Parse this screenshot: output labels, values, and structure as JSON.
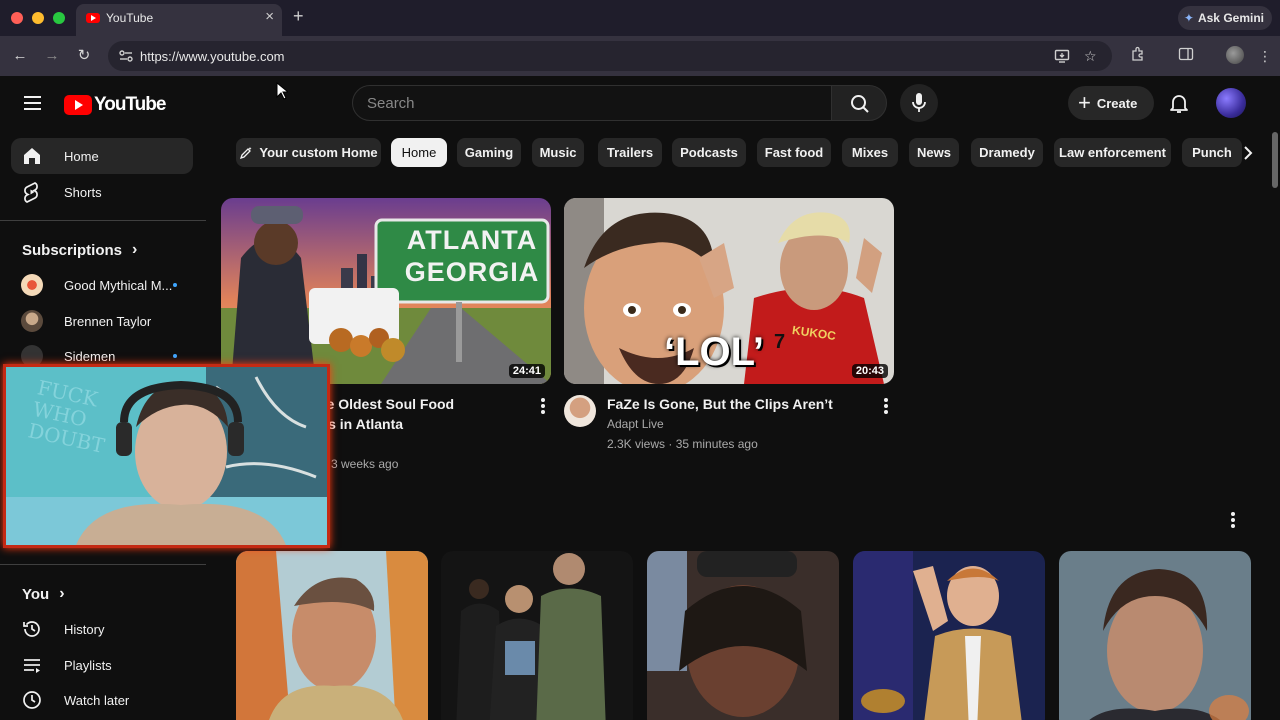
{
  "browser": {
    "tab_title": "YouTube",
    "tab_close": "×",
    "new_tab": "+",
    "ask_gemini": "Ask Gemini",
    "url": "https://www.youtube.com"
  },
  "header": {
    "logo_text": "YouTube",
    "search_placeholder": "Search",
    "create_label": "Create"
  },
  "sidebar": {
    "main": [
      {
        "label": "Home",
        "icon": "home-icon",
        "active": true
      },
      {
        "label": "Shorts",
        "icon": "shorts-icon"
      }
    ],
    "subscriptions_heading": "Subscriptions",
    "subscriptions": [
      {
        "label": "Good Mythical M...",
        "new": true
      },
      {
        "label": "Brennen Taylor",
        "new": false
      },
      {
        "label": "Sidemen",
        "new": true
      }
    ],
    "you_heading": "You",
    "you_items": [
      {
        "label": "History",
        "icon": "history-icon"
      },
      {
        "label": "Playlists",
        "icon": "playlists-icon"
      },
      {
        "label": "Watch later",
        "icon": "watch-later-icon"
      }
    ]
  },
  "chips": [
    "Your custom Home",
    "Home",
    "Gaming",
    "Music",
    "Trailers",
    "Podcasts",
    "Fast food",
    "Mixes",
    "News",
    "Dramedy",
    "Law enforcement",
    "Punch"
  ],
  "selected_chip": "Home",
  "videos": [
    {
      "thumb_text_1": "ATLANTA",
      "thumb_text_2": "GEORGIA",
      "duration": "24:41",
      "title_line1": "he Oldest Soul Food",
      "title_line2": "rts in Atlanta",
      "meta": "3 weeks ago"
    },
    {
      "thumb_text": "‘LOL’",
      "jersey_text": "KUKOC",
      "duration": "20:43",
      "title": "FaZe Is Gone, But the Clips Aren’t",
      "channel": "Adapt Live",
      "meta": "2.3K views · 35 minutes ago"
    }
  ],
  "webcam": {
    "whiteboard_text": "FUCK WHO DOUBT"
  },
  "colors": {
    "accent": "#ff0000",
    "background": "#0f0f0f",
    "chip": "#272727",
    "webcam_border": "#c42a14",
    "new_dot": "#3ea6ff"
  }
}
